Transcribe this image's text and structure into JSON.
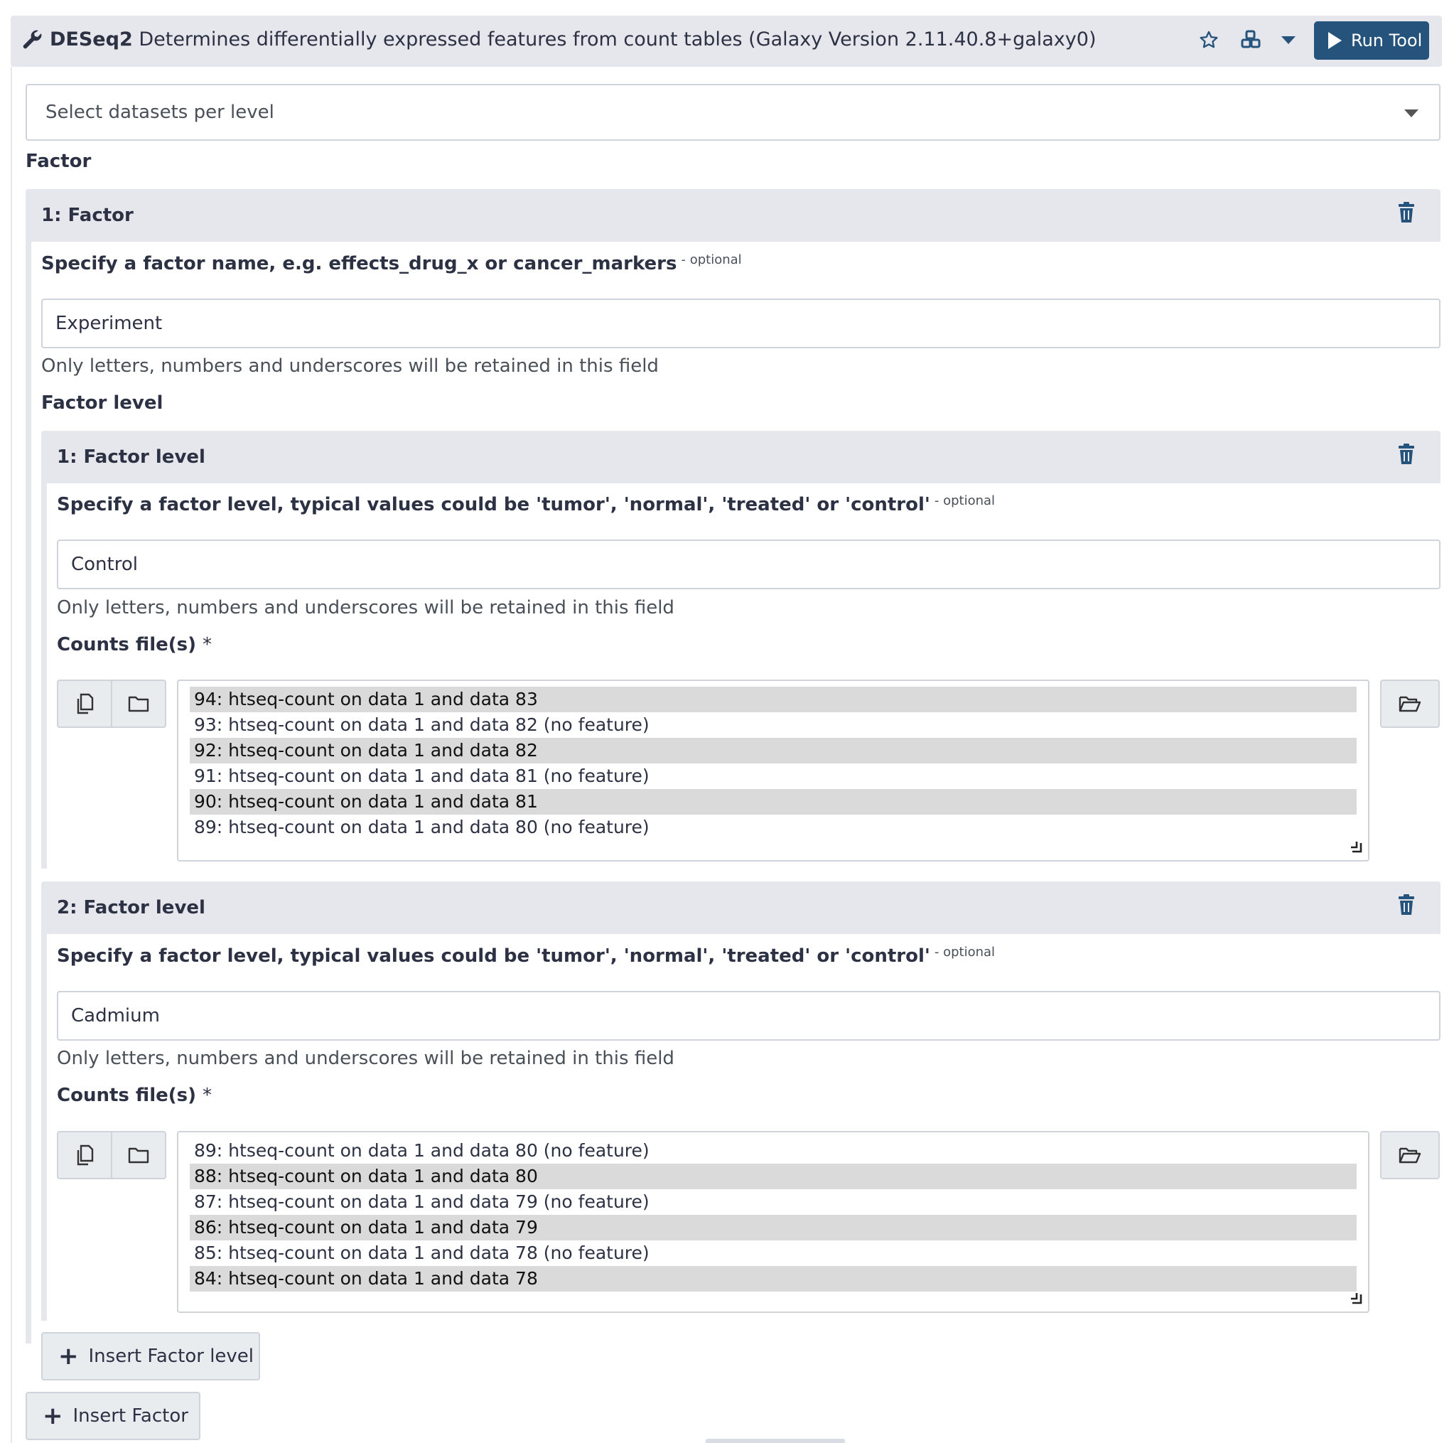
{
  "header": {
    "tool_name": "DESeq2",
    "description": "Determines differentially expressed features from count tables (Galaxy Version 2.11.40.8+galaxy0)",
    "run_label": "Run Tool"
  },
  "select_datasets": {
    "value": "Select datasets per level"
  },
  "factor_section": {
    "label": "Factor",
    "factors": [
      {
        "title": "1: Factor",
        "name_label": "Specify a factor name, e.g. effects_drug_x or cancer_markers",
        "optional": "- optional",
        "name_value": "Experiment",
        "help": "Only letters, numbers and underscores will be retained in this field",
        "levels_label": "Factor level",
        "levels": [
          {
            "title": "1: Factor level",
            "level_label": "Specify a factor level, typical values could be 'tumor', 'normal', 'treated' or 'control'",
            "optional": "- optional",
            "value": "Control",
            "help": "Only letters, numbers and underscores will be retained in this field",
            "counts_label": "Counts file(s)",
            "required": "*",
            "datasets": [
              {
                "text": "94: htseq-count on data 1 and data 83",
                "selected": true
              },
              {
                "text": "93: htseq-count on data 1 and data 82 (no feature)",
                "selected": false
              },
              {
                "text": "92: htseq-count on data 1 and data 82",
                "selected": true
              },
              {
                "text": "91: htseq-count on data 1 and data 81 (no feature)",
                "selected": false
              },
              {
                "text": "90: htseq-count on data 1 and data 81",
                "selected": true
              },
              {
                "text": "89: htseq-count on data 1 and data 80 (no feature)",
                "selected": false
              }
            ]
          },
          {
            "title": "2: Factor level",
            "level_label": "Specify a factor level, typical values could be 'tumor', 'normal', 'treated' or 'control'",
            "optional": "- optional",
            "value": "Cadmium",
            "help": "Only letters, numbers and underscores will be retained in this field",
            "counts_label": "Counts file(s)",
            "required": "*",
            "datasets": [
              {
                "text": "89: htseq-count on data 1 and data 80 (no feature)",
                "selected": false
              },
              {
                "text": "88: htseq-count on data 1 and data 80",
                "selected": true
              },
              {
                "text": "87: htseq-count on data 1 and data 79 (no feature)",
                "selected": false
              },
              {
                "text": "86: htseq-count on data 1 and data 79",
                "selected": true
              },
              {
                "text": "85: htseq-count on data 1 and data 78 (no feature)",
                "selected": false
              },
              {
                "text": "84: htseq-count on data 1 and data 78",
                "selected": true
              }
            ]
          }
        ],
        "insert_level_label": "Insert Factor level"
      }
    ],
    "insert_factor_label": "Insert Factor"
  },
  "icons": {
    "tool": "wrench-icon",
    "favorite": "star-icon",
    "workflow": "objects-icon",
    "options": "caret-down-icon",
    "run": "play-icon",
    "delete": "trash-icon",
    "multiple": "copy-files-icon",
    "collection": "folder-icon",
    "browse": "folder-open-icon",
    "add": "plus-icon"
  },
  "colors": {
    "primary": "#25537b",
    "header_bg": "#e5e7ec",
    "selected_row": "#dadada"
  }
}
